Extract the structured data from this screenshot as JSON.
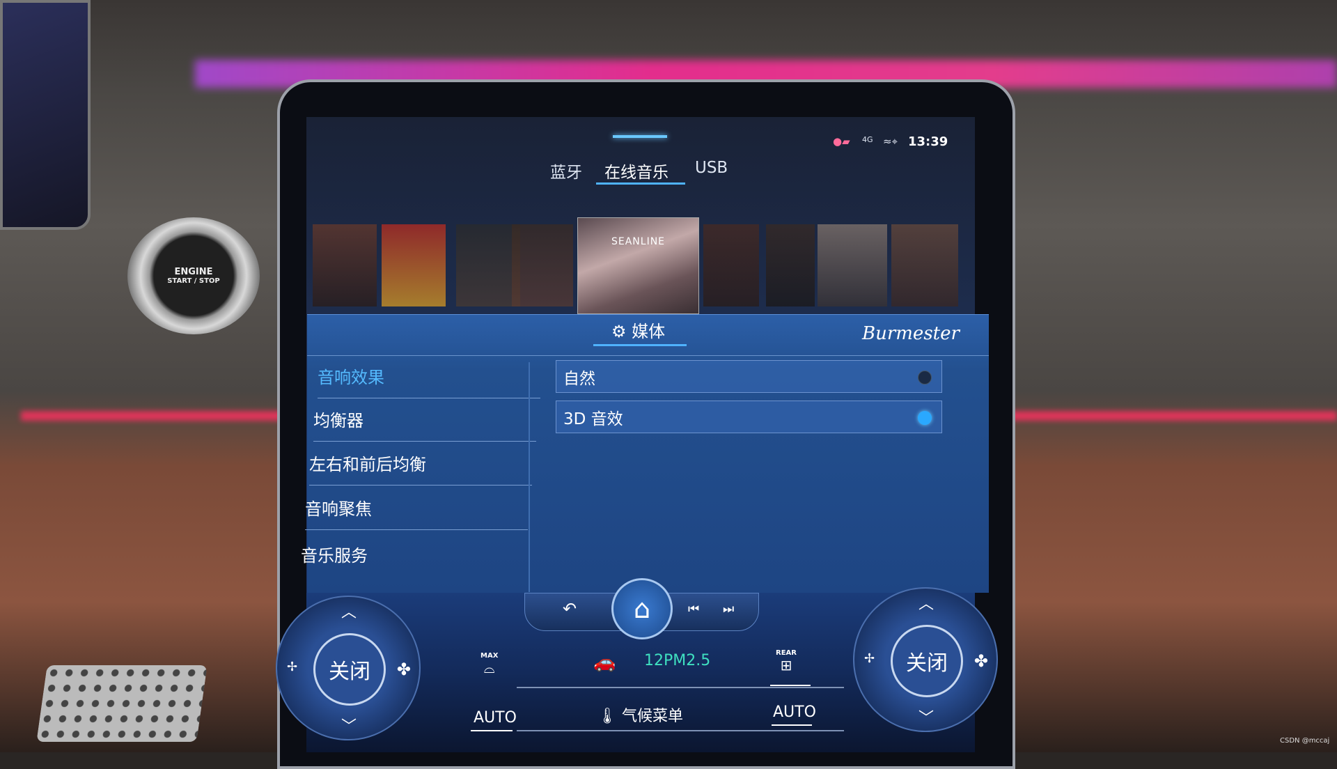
{
  "status_bar": {
    "time": "13:39",
    "icons": [
      "camera-icon",
      "4g-icon",
      "wifi-location-icon"
    ]
  },
  "tabs": [
    {
      "label": "蓝牙",
      "active": false
    },
    {
      "label": "在线音乐",
      "active": true
    },
    {
      "label": "USB",
      "active": false
    }
  ],
  "albums": {
    "center_title": "SEANLINE"
  },
  "panel": {
    "title": "媒体",
    "title_icon": "gear-icon",
    "brand": "Burmester"
  },
  "menu": [
    {
      "label": "音响效果",
      "active": true
    },
    {
      "label": "均衡器"
    },
    {
      "label": "左右和前后均衡"
    },
    {
      "label": "音响聚焦"
    },
    {
      "label": "音乐服务"
    }
  ],
  "options": [
    {
      "label": "自然",
      "selected": false
    },
    {
      "label": "3D 音效",
      "selected": true
    }
  ],
  "nav": {
    "back": "back-icon",
    "home": "home-icon",
    "prev": "skip-previous-icon",
    "next": "skip-next-icon"
  },
  "climate": {
    "left_dial": {
      "label": "关闭"
    },
    "right_dial": {
      "label": "关闭"
    },
    "front_defrost": "MAX",
    "air_quality": "12PM2.5",
    "rear_defrost": "REAR",
    "left_auto": "AUTO",
    "menu_label": "气候菜单",
    "right_auto": "AUTO"
  },
  "engine_button": {
    "line1": "ENGINE",
    "line2": "START / STOP"
  },
  "watermark": "CSDN @mccaj",
  "colors": {
    "accent": "#4fb3ff",
    "active_menu": "#55bbff",
    "air_quality": "#3fe0c0",
    "ambient": "#ff2a9a"
  }
}
